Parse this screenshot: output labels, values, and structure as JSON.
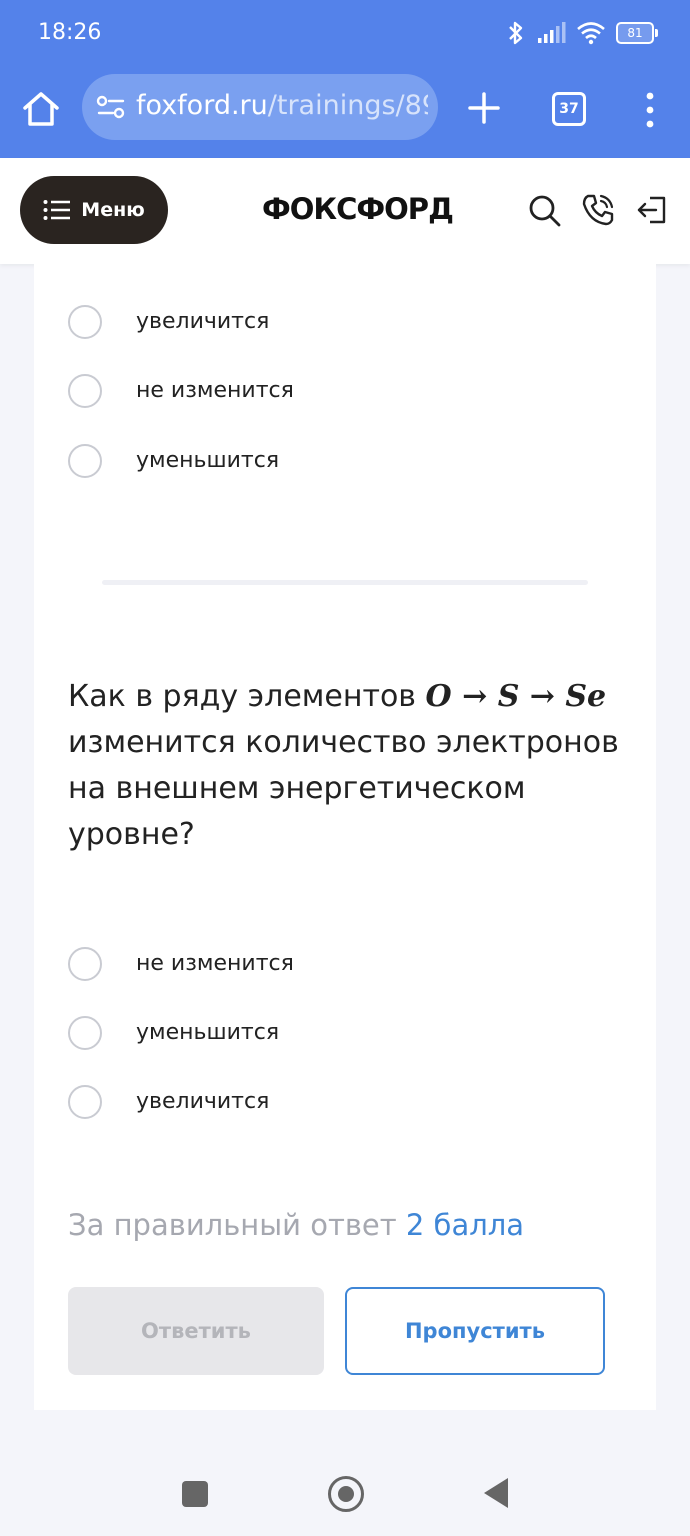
{
  "status_bar": {
    "time": "18:26",
    "battery": "81"
  },
  "browser": {
    "url_domain": "foxford.ru",
    "url_path": "/trainings/89",
    "tab_count": "37"
  },
  "header": {
    "menu_label": "Меню",
    "logo": "ФОКСФОРД"
  },
  "previous_question": {
    "options": [
      "увеличится",
      "не изменится",
      "уменьшится"
    ]
  },
  "question": {
    "text_before": "Как в ряду элементов ",
    "formula": "O → S → Se",
    "text_after": " изменится количество электронов на внешнем энергетическом уровне?",
    "options": [
      "не изменится",
      "уменьшится",
      "увеличится"
    ]
  },
  "score": {
    "prefix": "За правильный ответ ",
    "value": "2 балла"
  },
  "buttons": {
    "answer": "Ответить",
    "skip": "Пропустить"
  },
  "colors": {
    "brand_blue": "#5482ea",
    "accent": "#3f86d6",
    "menu_dark": "#2a2420"
  }
}
